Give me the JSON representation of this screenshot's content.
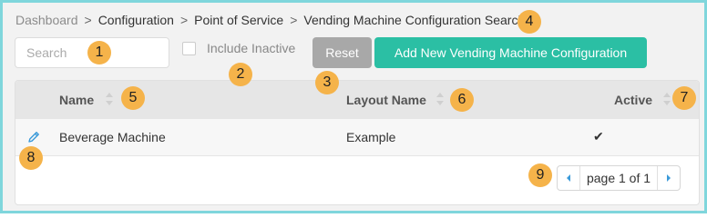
{
  "breadcrumb": {
    "items": [
      {
        "label": "Dashboard"
      },
      {
        "label": "Configuration"
      },
      {
        "label": "Point of Service"
      },
      {
        "label": "Vending Machine Configuration Search"
      }
    ],
    "separator": ">"
  },
  "toolbar": {
    "search_placeholder": "Search",
    "search_value": "",
    "include_inactive_label": "Include Inactive",
    "include_inactive_checked": false,
    "reset_label": "Reset",
    "add_label": "Add New Vending Machine Configuration"
  },
  "table": {
    "columns": {
      "name": "Name",
      "layout": "Layout Name",
      "active": "Active"
    },
    "rows": [
      {
        "name": "Beverage Machine",
        "layout": "Example",
        "active": "✔"
      }
    ]
  },
  "pagination": {
    "text": "page 1 of 1",
    "prev_icon": "caret-left-icon",
    "next_icon": "caret-right-icon"
  },
  "callouts": [
    "1",
    "2",
    "3",
    "4",
    "5",
    "6",
    "7",
    "8",
    "9"
  ],
  "colors": {
    "accent": "#2bbfa4",
    "reset": "#a8a8a8",
    "callout": "#f5b34a",
    "frame": "#7fd6dc",
    "link": "#3a9ad9"
  }
}
